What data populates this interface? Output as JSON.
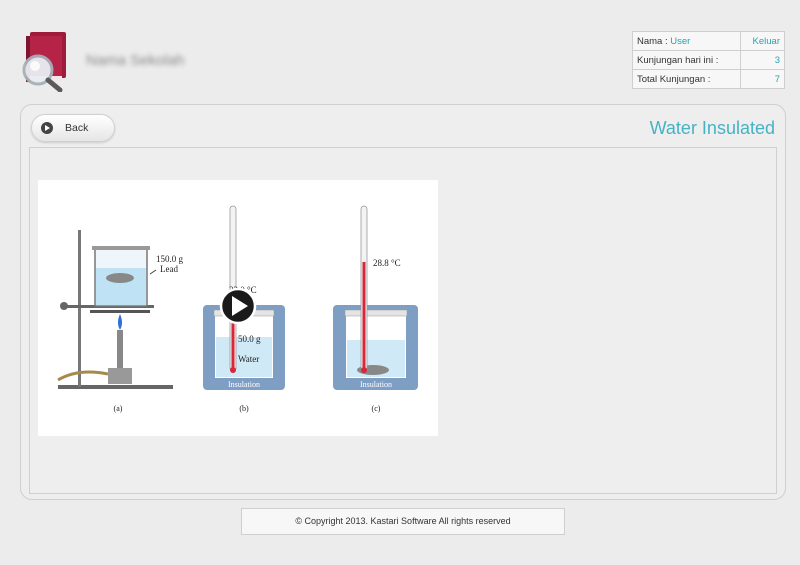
{
  "header": {
    "school_name": "Nama Sekolah",
    "info": {
      "name_label": "Nama :",
      "name_value": "User",
      "logout_label": "Keluar",
      "visits_today_label": "Kunjungan hari ini :",
      "visits_today_value": "3",
      "total_visits_label": "Total Kunjungan :",
      "total_visits_value": "7"
    }
  },
  "toolbar": {
    "back_label": "Back",
    "page_title": "Water Insulated"
  },
  "figure": {
    "mass_lead": "150.0 g",
    "lead_label": "Lead",
    "temp_b": "22.0 °C",
    "mass_water": "50.0 g",
    "water_label": "Water",
    "temp_c": "28.8 °C",
    "insulation_label": "Insulation",
    "caption_a": "(a)",
    "caption_b": "(b)",
    "caption_c": "(c)"
  },
  "footer": {
    "copyright": "© Copyright 2013. Kastari Software All rights reserved"
  },
  "colors": {
    "accent": "#45b3c4",
    "thermometer_red": "#d9263b",
    "water_blue": "#cfe9f7",
    "insulation_blue": "#7f9ec4"
  }
}
